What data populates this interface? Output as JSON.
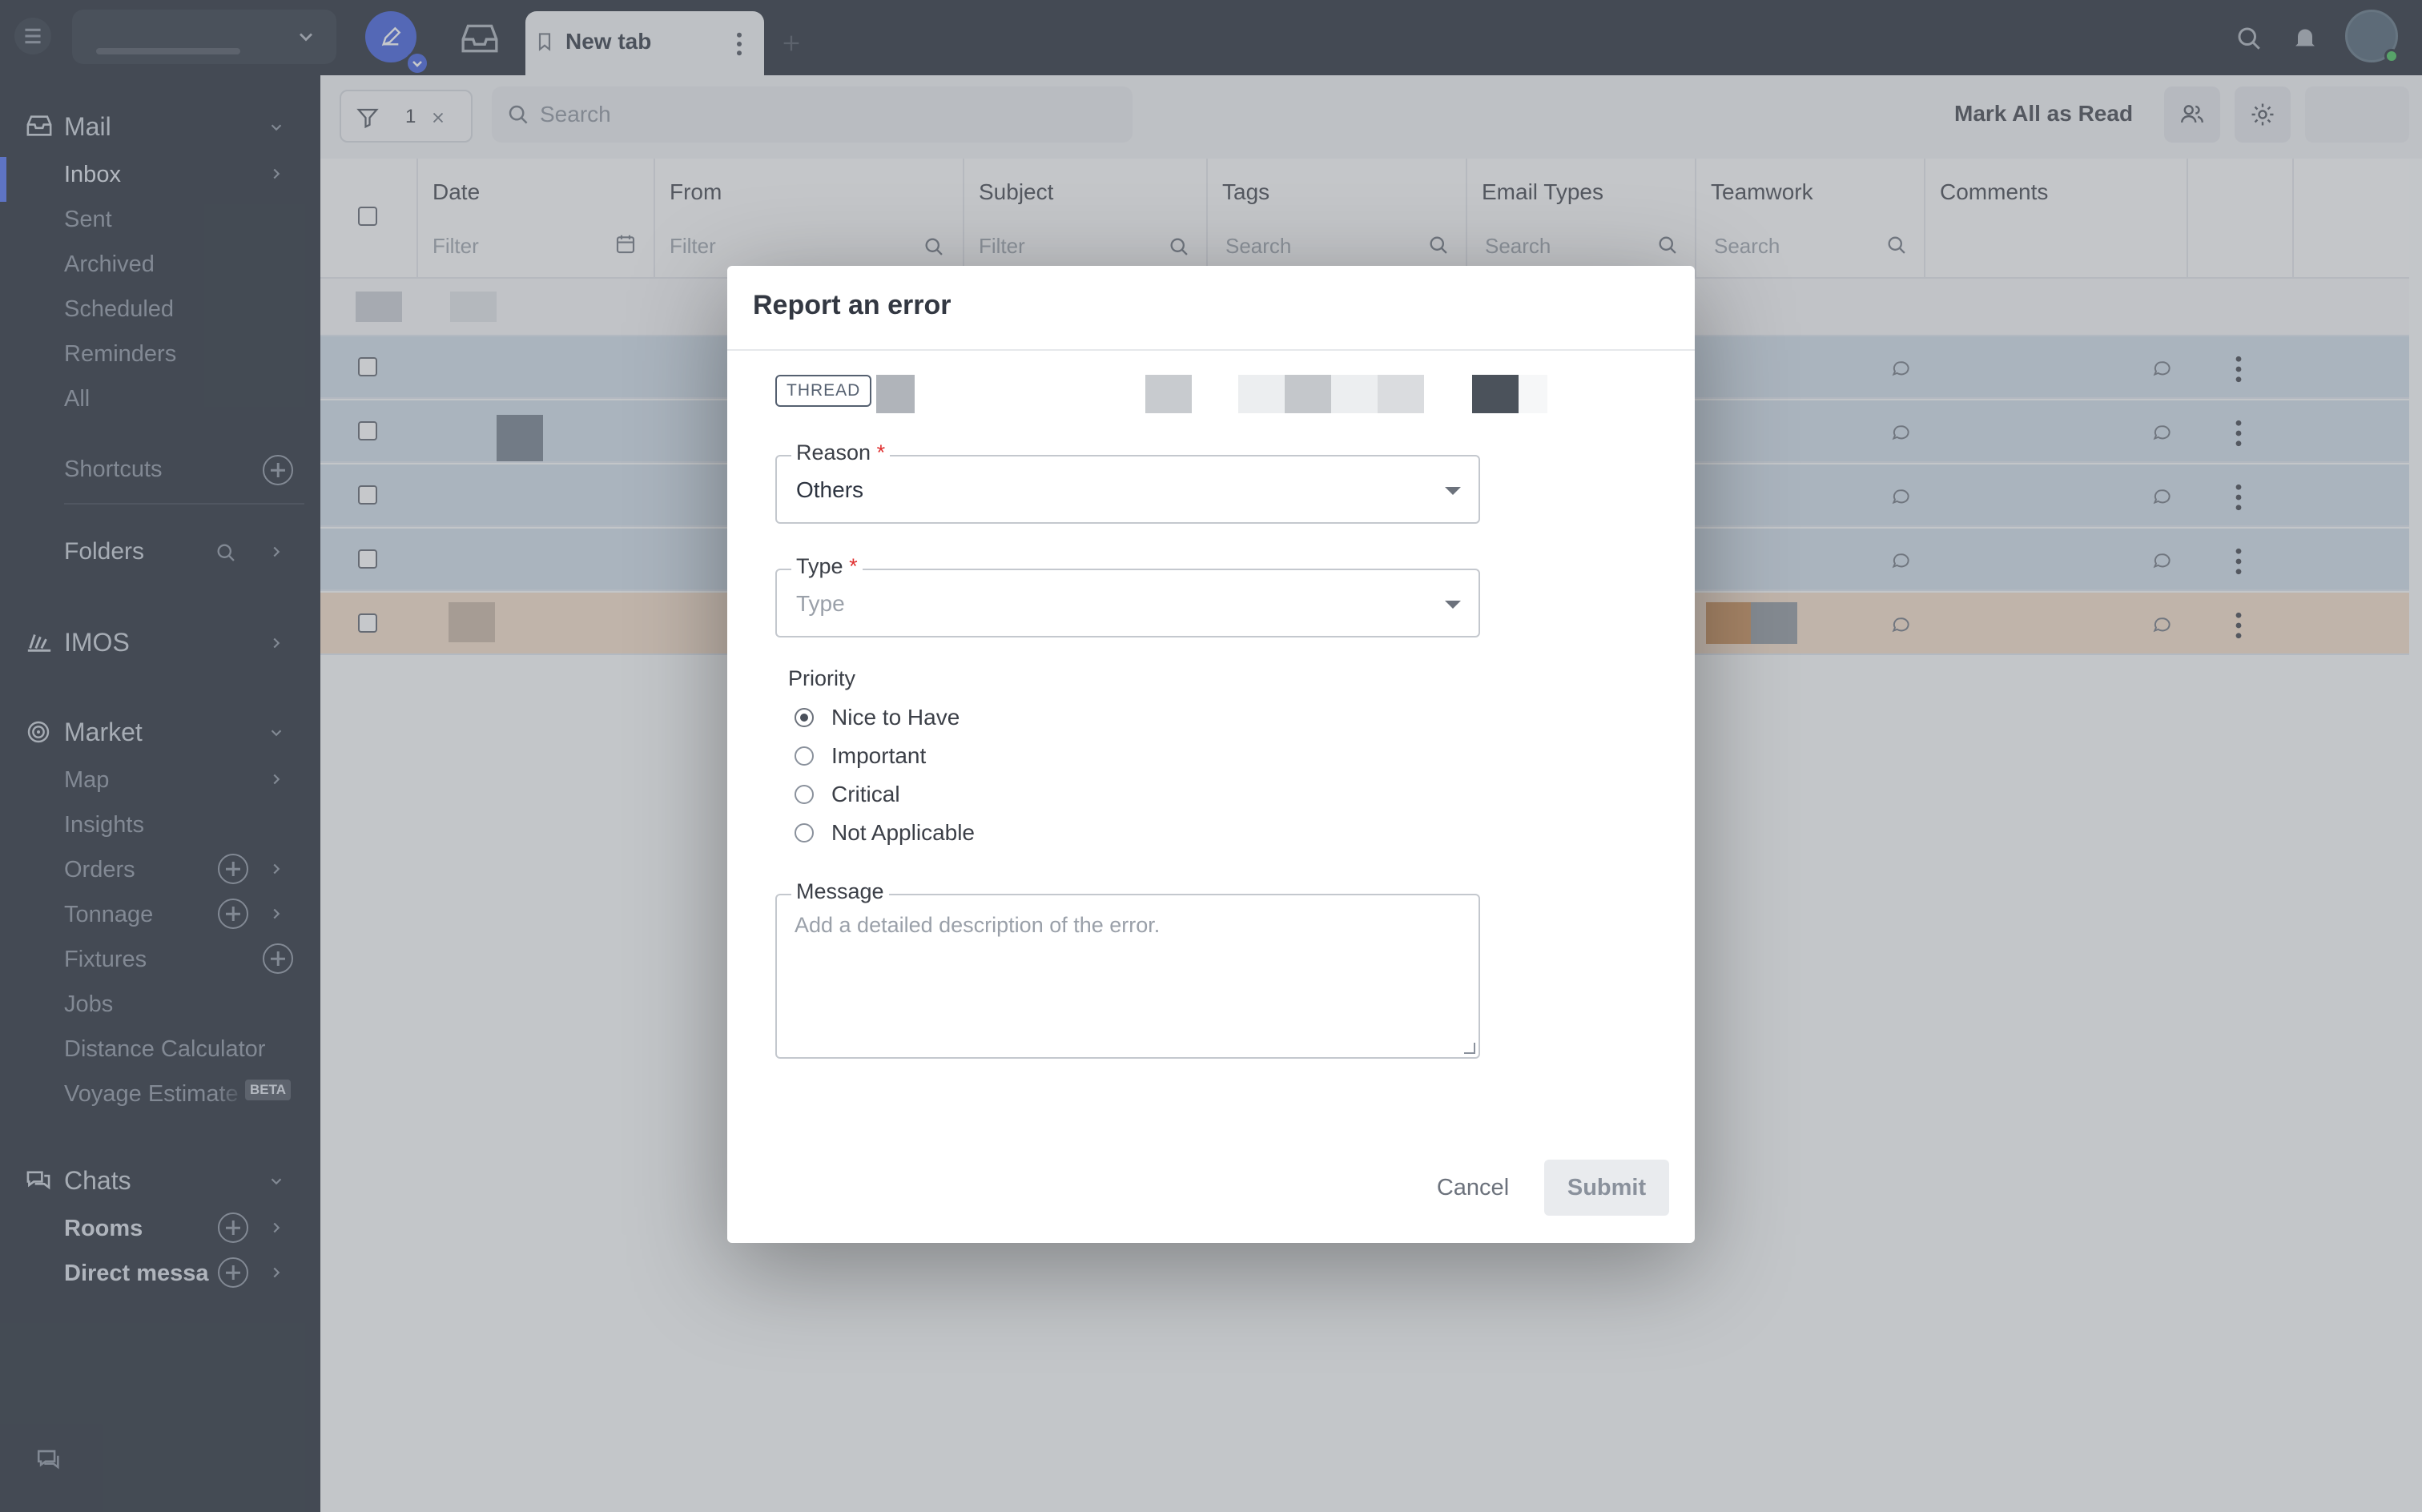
{
  "topbar": {
    "tab_label": "New tab",
    "icons": [
      "menu-icon",
      "chevron-down-icon",
      "compose-icon",
      "inbox-icon",
      "bookmark-icon",
      "more-vertical-icon",
      "add-tab-icon",
      "search-icon",
      "bell-icon",
      "avatar"
    ]
  },
  "sidebar": {
    "mail": {
      "heading": "Mail",
      "items": [
        {
          "label": "Inbox",
          "active": true
        },
        {
          "label": "Sent"
        },
        {
          "label": "Archived"
        },
        {
          "label": "Scheduled"
        },
        {
          "label": "Reminders"
        },
        {
          "label": "All"
        }
      ]
    },
    "shortcuts": "Shortcuts",
    "folders": "Folders",
    "imos": "IMOS",
    "market": {
      "heading": "Market",
      "items": [
        {
          "label": "Map"
        },
        {
          "label": "Insights"
        },
        {
          "label": "Orders"
        },
        {
          "label": "Tonnage"
        },
        {
          "label": "Fixtures"
        },
        {
          "label": "Jobs"
        },
        {
          "label": "Distance Calculator"
        },
        {
          "label": "Voyage Estimate",
          "badge": "BETA"
        }
      ]
    },
    "chats": {
      "heading": "Chats",
      "items": [
        {
          "label": "Rooms"
        },
        {
          "label": "Direct messa"
        }
      ]
    }
  },
  "toolbar": {
    "filter_count": "1",
    "search_placeholder": "Search",
    "mark_all_read": "Mark All as Read"
  },
  "table": {
    "columns": [
      {
        "title": "Date",
        "filter": "Filter"
      },
      {
        "title": "From",
        "filter": "Filter"
      },
      {
        "title": "Subject",
        "filter": "Filter"
      },
      {
        "title": "Tags",
        "filter": "Search"
      },
      {
        "title": "Email Types",
        "filter": "Search"
      },
      {
        "title": "Teamwork",
        "filter": "Search"
      },
      {
        "title": "Comments",
        "filter": ""
      }
    ]
  },
  "modal": {
    "title": "Report an error",
    "badge": "THREAD",
    "reason": {
      "label": "Reason",
      "required": "*",
      "value": "Others"
    },
    "type": {
      "label": "Type",
      "required": "*",
      "placeholder": "Type"
    },
    "priority": {
      "label": "Priority",
      "options": [
        "Nice to Have",
        "Important",
        "Critical",
        "Not Applicable"
      ],
      "selected": "Nice to Have"
    },
    "message": {
      "label": "Message",
      "placeholder": "Add a detailed description of the error."
    },
    "cancel": "Cancel",
    "submit": "Submit"
  },
  "colors": {
    "sidebar_bg": "#1f2733",
    "accent": "#4c6ef5",
    "required": "#e03131",
    "row_highlight": "#cfdde9"
  }
}
